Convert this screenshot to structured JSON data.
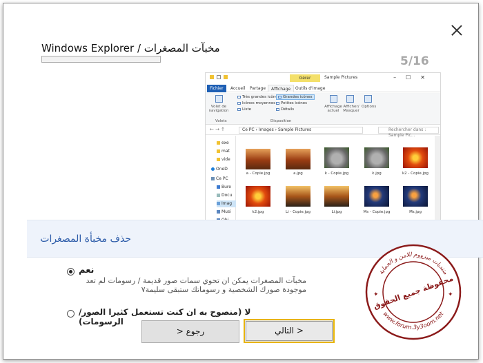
{
  "window": {
    "title": "مخبآت المصغرات / Windows Explorer",
    "step": "5/16",
    "progress_fraction": 0.0
  },
  "explorer": {
    "manage_tab": "Gérer",
    "window_title": "Sample Pictures",
    "tabs": [
      "Fichier",
      "Accueil",
      "Partage",
      "Affichage",
      "Outils d'image"
    ],
    "ribbon": {
      "nav_pane": "Volet de navigation",
      "panes_group": "Volets",
      "layout_options": [
        "Très grandes icônes",
        "Grandes icônes",
        "Icônes moyennes",
        "Petites icônes",
        "Liste",
        "Détails"
      ],
      "layout_group": "Disposition",
      "current_view": "Affichage actuel",
      "show_hide": "Afficher/ Masquer",
      "options": "Options"
    },
    "path": [
      "Ce PC",
      "Images",
      "Sample Pictures"
    ],
    "search_placeholder": "Rechercher dans : Sample Pic...",
    "nav_items": [
      "exe",
      "mat",
      "vide",
      "OneD",
      "Ce PC",
      "Bure",
      "Docu",
      "Imag",
      "Musi",
      "Obj"
    ],
    "files": [
      "a - Copie.jpg",
      "a.jpg",
      "k - Copie.jpg",
      "k.jpg",
      "k2 - Copie.jpg",
      "k2.jpg",
      "Li - Copie.jpg",
      "Li.jpg",
      "Ms - Copie.jpg",
      "Ms.jpg"
    ]
  },
  "section": {
    "heading": "حذف مخبأة المصغرات"
  },
  "options": {
    "yes_label": "نعم",
    "yes_desc": "مخبآت المصغرات يمكن ان تحوي سمات صور قديمة / رسومات لم تعد موجودة صورك الشخصية و رسوماتك ستبقى سليمة٧",
    "no_label": "لا (منصوح به ان كنت تستعمل كثيرا الصور/الرسومات)",
    "selected": "yes"
  },
  "buttons": {
    "back": "رجوع <",
    "next": "< التالي"
  },
  "stamp": {
    "text": "محفوظة جميع الحقوق",
    "url": "www.forum.3y3oom.net",
    "ring": "منتديات ميزووم للامن و الحماية"
  },
  "colors": {
    "accent": "#2a5aa8",
    "focus": "#e8b400",
    "stamp": "#8b1a1a"
  }
}
